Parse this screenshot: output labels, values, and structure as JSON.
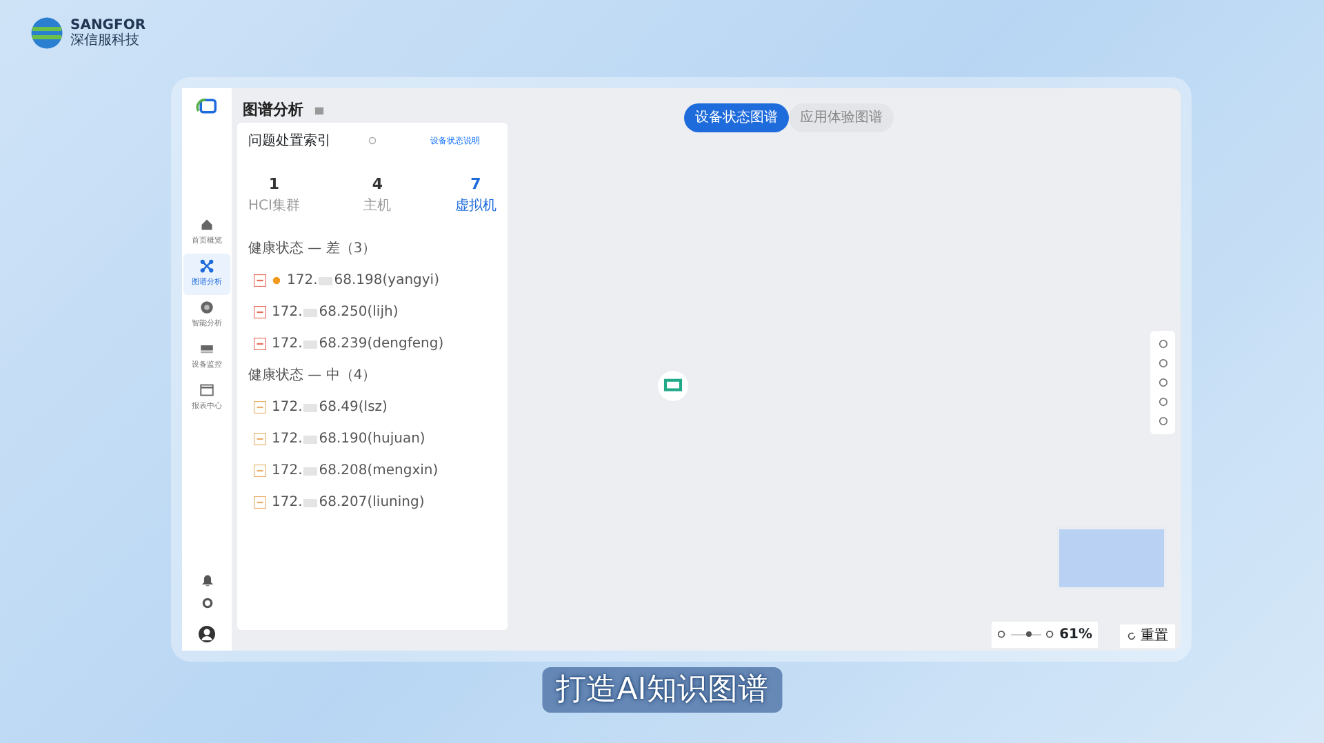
{
  "brand": {
    "name": "SANGFOR",
    "subtitle": "深信服科技"
  },
  "sidebar": {
    "items": [
      {
        "label": "首页概览",
        "selected": false
      },
      {
        "label": "图谱分析",
        "selected": true
      },
      {
        "label": "智能分析",
        "selected": false
      },
      {
        "label": "设备监控",
        "selected": false
      },
      {
        "label": "报表中心",
        "selected": false
      }
    ]
  },
  "page_title": "图谱分析",
  "index_panel": {
    "title": "问题处置索引",
    "help_link": "设备状态说明",
    "stats": [
      {
        "value": "1",
        "label": "HCI集群",
        "selected": false
      },
      {
        "value": "4",
        "label": "主机",
        "selected": false
      },
      {
        "value": "7",
        "label": "虚拟机",
        "selected": true
      }
    ],
    "groups": [
      {
        "label": "健康状态 — 差（3）",
        "color": "#e86b5a",
        "items": [
          {
            "ip_prefix": "172.",
            "ip_suffix": "68.198(yangyi)",
            "alert": true
          },
          {
            "ip_prefix": "172.",
            "ip_suffix": "68.250(lijh)",
            "alert": false
          },
          {
            "ip_prefix": "172.",
            "ip_suffix": "68.239(dengfeng)",
            "alert": false
          }
        ]
      },
      {
        "label": "健康状态 — 中（4）",
        "color": "#e8b06a",
        "items": [
          {
            "ip_prefix": "172.",
            "ip_suffix": "68.49(lsz)",
            "alert": false
          },
          {
            "ip_prefix": "172.",
            "ip_suffix": "68.190(hujuan)",
            "alert": false
          },
          {
            "ip_prefix": "172.",
            "ip_suffix": "68.208(mengxin)",
            "alert": false
          },
          {
            "ip_prefix": "172.",
            "ip_suffix": "68.207(liuning)",
            "alert": false
          }
        ]
      }
    ]
  },
  "tabs": [
    {
      "label": "设备状态图谱",
      "selected": true
    },
    {
      "label": "应用体验图谱",
      "selected": false
    }
  ],
  "zoom": {
    "level": 0.61,
    "reading": "61%",
    "reset": "重置"
  },
  "caption": "打造AI知识图谱"
}
